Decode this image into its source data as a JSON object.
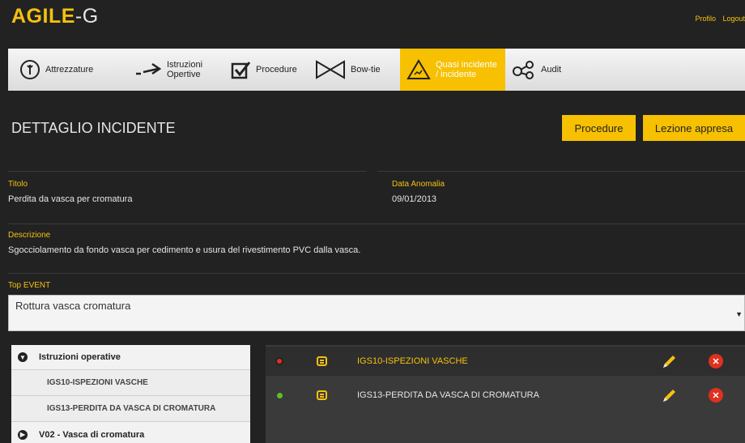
{
  "brand": {
    "part1": "AGILE",
    "part2": "-G"
  },
  "top_links": {
    "profile": "Profilo",
    "logout": "Logout"
  },
  "nav": [
    {
      "label": "Attrezzature",
      "icon": "wrench-circle-icon"
    },
    {
      "label": "Istruzioni\nOpertive",
      "icon": "arrow-right-icon"
    },
    {
      "label": "Procedure",
      "icon": "checkbox-icon"
    },
    {
      "label": "Bow-tie",
      "icon": "bowtie-icon"
    },
    {
      "label": "Quasi incidente\n/ incidente",
      "icon": "warning-icon",
      "active": true
    },
    {
      "label": "Audit",
      "icon": "connection-icon"
    }
  ],
  "page": {
    "title": "DETTAGLIO INCIDENTE",
    "btn_procedure": "Procedure",
    "btn_lezione": "Lezione appresa"
  },
  "details": {
    "titolo_label": "Titolo",
    "titolo_value": "Perdita da vasca per cromatura",
    "data_label": "Data Anomalia",
    "data_value": "09/01/2013",
    "descrizione_label": "Descrizione",
    "descrizione_value": "Sgocciolamento da fondo vasca per cedimento e usura del rivestimento PVC dalla vasca.",
    "top_event_label": "Top EVENT",
    "top_event_value": "Rottura vasca cromatura"
  },
  "accordion": {
    "section1": "Istruzioni operative",
    "items": [
      "IGS10-ISPEZIONI VASCHE",
      "IGS13-PERDITA DA VASCA DI CROMATURA"
    ],
    "section2": "V02 - Vasca di cromatura"
  },
  "rows": [
    {
      "text": "IGS10-ISPEZIONI VASCHE",
      "status_color": "#e0301e",
      "highlight": true
    },
    {
      "text": "IGS13-PERDITA DA VASCA DI CROMATURA",
      "status_color": "#5cbf2a",
      "highlight": false
    }
  ],
  "colors": {
    "accent": "#f7c000",
    "background": "#222222",
    "danger": "#e0301e",
    "ok": "#5cbf2a"
  }
}
